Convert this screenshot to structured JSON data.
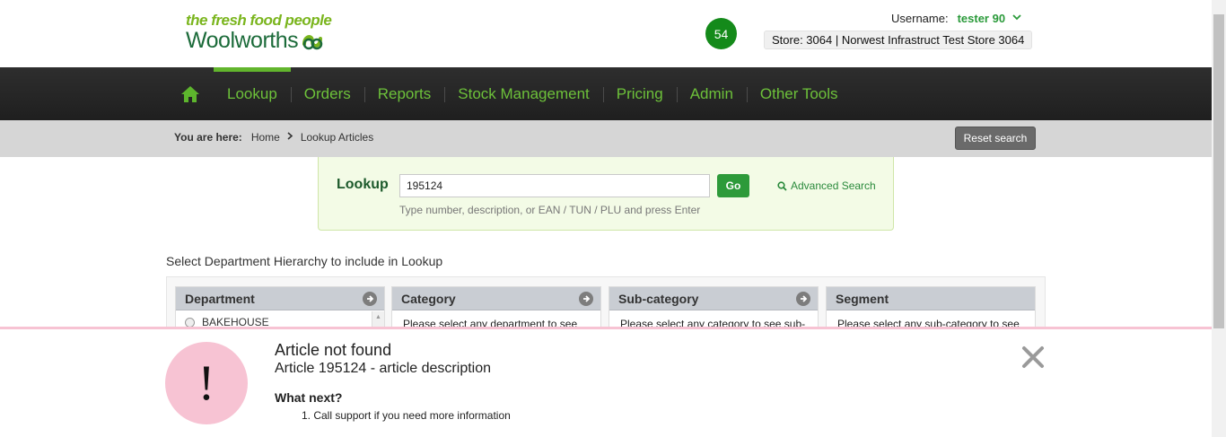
{
  "header": {
    "tagline": "the fresh food people",
    "brand": "Woolworths",
    "notification_count": "54",
    "username_label": "Username:",
    "username": "tester 90",
    "store": "Store: 3064 | Norwest Infrastruct Test Store 3064"
  },
  "nav": {
    "items": [
      {
        "label": "Lookup",
        "active": true
      },
      {
        "label": "Orders"
      },
      {
        "label": "Reports"
      },
      {
        "label": "Stock Management"
      },
      {
        "label": "Pricing"
      },
      {
        "label": "Admin"
      },
      {
        "label": "Other Tools"
      }
    ]
  },
  "breadcrumb": {
    "label": "You are here:",
    "items": [
      "Home",
      "Lookup Articles"
    ],
    "reset_label": "Reset search"
  },
  "lookup": {
    "label": "Lookup",
    "value": "195124",
    "go_label": "Go",
    "advanced_label": "Advanced Search",
    "hint": "Type number, description, or EAN / TUN / PLU and press Enter"
  },
  "hierarchy": {
    "title": "Select Department Hierarchy to include in Lookup",
    "columns": [
      {
        "header": "Department",
        "body": "BAKEHOUSE"
      },
      {
        "header": "Category",
        "body": "Please select any department to see it's"
      },
      {
        "header": "Sub-category",
        "body": "Please select any category to see sub-"
      },
      {
        "header": "Segment",
        "body": "Please select any sub-category to see"
      }
    ]
  },
  "notice": {
    "title": "Article not found",
    "subtitle": "Article 195124 - article description",
    "next_heading": "What next?",
    "steps": [
      "1. Call support if you need more information"
    ]
  },
  "colors": {
    "brand_green": "#1c6b3a",
    "nav_green": "#6dc13a",
    "alert_pink": "#f7c3d3"
  }
}
